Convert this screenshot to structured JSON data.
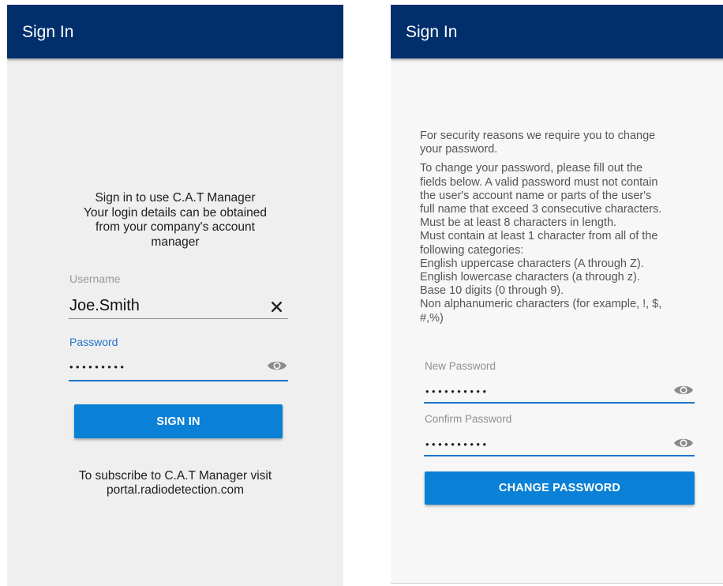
{
  "signin_screen": {
    "appbar_title": "Sign In",
    "intro_lines": [
      "Sign in to use C.A.T Manager",
      "Your login details can be obtained",
      "from your company's account",
      "manager"
    ],
    "username": {
      "label": "Username",
      "value": "Joe.Smith"
    },
    "password": {
      "label": "Password",
      "value": "•••••••••"
    },
    "signin_label": "SIGN IN",
    "footer_lines": [
      "To subscribe to C.A.T Manager visit",
      "portal.radiodetection.com"
    ]
  },
  "change_password_screen": {
    "appbar_title": "Sign In",
    "security_lines": [
      "For security reasons we require you to change",
      "your password."
    ],
    "requirement_lines": [
      "To change your password, please fill out the",
      "fields below. A valid password must not contain",
      "the user's account name or parts of the user's",
      "full name that exceed 3 consecutive characters.",
      "Must be at least 8 characters in length.",
      "Must contain at least 1 character from all of the",
      "following categories:",
      "English uppercase characters (A through Z).",
      "English lowercase characters (a through z).",
      "Base 10 digits (0 through 9).",
      "Non alphanumeric characters (for example, !, $,",
      "#,%)"
    ],
    "new_password": {
      "label": "New Password",
      "value": "••••••••••"
    },
    "confirm_password": {
      "label": "Confirm Password",
      "value": "••••••••••"
    },
    "change_password_label": "CHANGE PASSWORD"
  },
  "icons": {
    "clear": "close-icon",
    "visibility": "eye-icon"
  },
  "colors": {
    "appbar": "#002f6c",
    "primary_button": "#0a80d6",
    "focused_field": "#1f74c8",
    "left_background": "#efefef",
    "right_background": "#f7f7f7"
  }
}
